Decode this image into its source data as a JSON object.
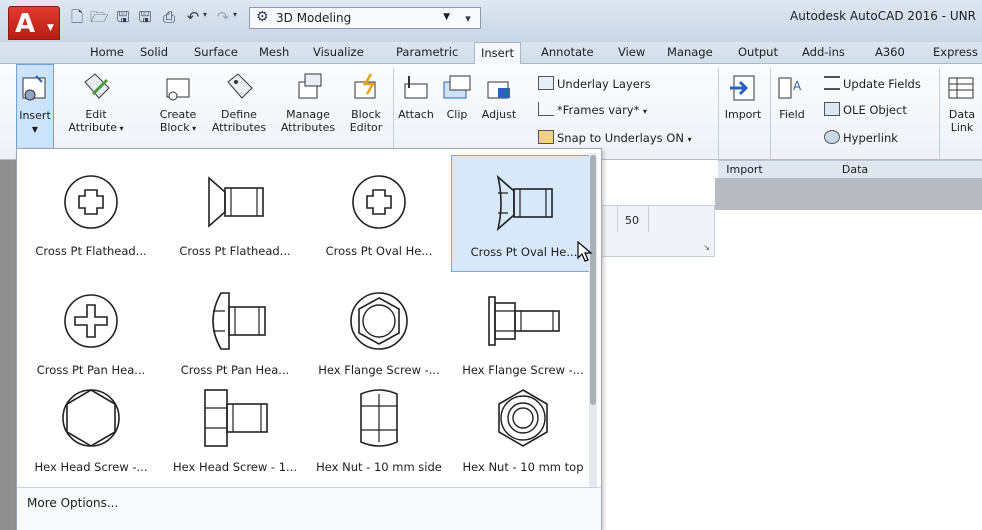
{
  "titlebar": {
    "workspace": "3D Modeling",
    "title": "Autodesk AutoCAD 2016 - UNR"
  },
  "tabs": [
    "Home",
    "Solid",
    "Surface",
    "Mesh",
    "Visualize",
    "Parametric",
    "Insert",
    "Annotate",
    "View",
    "Manage",
    "Output",
    "Add-ins",
    "A360",
    "Express"
  ],
  "active_tab": "Insert",
  "ribbon": {
    "insert": "Insert",
    "edit_attribute_1": "Edit",
    "edit_attribute_2": "Attribute",
    "create_block_1": "Create",
    "create_block_2": "Block",
    "define_attr_1": "Define",
    "define_attr_2": "Attributes",
    "manage_attr_1": "Manage",
    "manage_attr_2": "Attributes",
    "block_editor_1": "Block",
    "block_editor_2": "Editor",
    "attach": "Attach",
    "clip": "Clip",
    "adjust": "Adjust",
    "underlay_layers": "Underlay Layers",
    "frames_vary": "*Frames vary*",
    "snap_underlays": "Snap to Underlays ON",
    "import": "Import",
    "import_panel": "Import",
    "field": "Field",
    "update_fields": "Update Fields",
    "ole_object": "OLE Object",
    "hyperlink": "Hyperlink",
    "data_panel": "Data",
    "data_link_1": "Data",
    "data_link_2": "Link"
  },
  "ruler_value": "50",
  "gallery": {
    "items": [
      "Cross Pt Flathead...",
      "Cross Pt Flathead...",
      "Cross Pt Oval He...",
      "Cross Pt Oval He...",
      "Cross Pt Pan Hea...",
      "Cross Pt Pan Hea...",
      "Hex Flange Screw -...",
      "Hex Flange Screw -...",
      "Hex Head Screw -...",
      "Hex Head Screw - 1...",
      "Hex Nut - 10 mm side",
      "Hex Nut - 10 mm top"
    ],
    "hovered_index": 3,
    "more_options": "More Options..."
  },
  "colors": {
    "app_red": "#c8261c",
    "hover_blue": "#d7e8fa",
    "ribbon_bg": "#eef2f7"
  }
}
